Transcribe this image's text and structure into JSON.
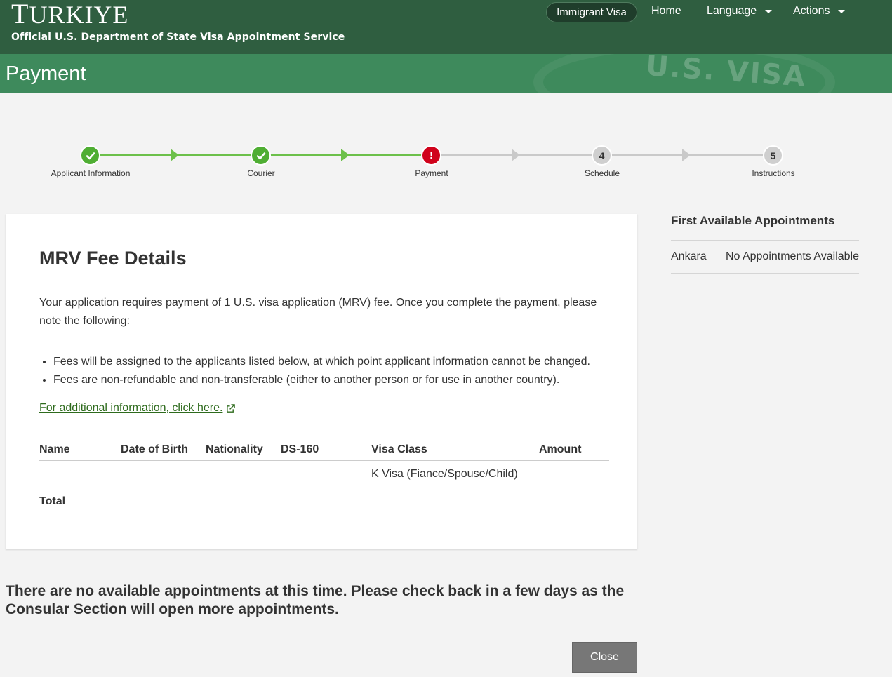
{
  "header": {
    "country_first": "T",
    "country_rest": "URKIYE",
    "subtitle": "Official U.S. Department of State Visa Appointment Service",
    "nav": {
      "immigrant_visa": "Immigrant Visa",
      "home": "Home",
      "language": "Language",
      "actions": "Actions"
    }
  },
  "page": {
    "title": "Payment",
    "watermark": "U.S. VISA"
  },
  "stepper": {
    "steps": [
      {
        "label": "Applicant Information",
        "status": "done",
        "number": ""
      },
      {
        "label": "Courier",
        "status": "done",
        "number": ""
      },
      {
        "label": "Payment",
        "status": "error",
        "number": "!"
      },
      {
        "label": "Schedule",
        "status": "todo",
        "number": "4"
      },
      {
        "label": "Instructions",
        "status": "todo",
        "number": "5"
      }
    ],
    "colors": {
      "done": "#4fae33",
      "error": "#d0021b",
      "todo": "#cfcfcf"
    }
  },
  "fee": {
    "heading": "MRV Fee Details",
    "intro": "Your application requires payment of 1 U.S. visa application (MRV) fee. Once you complete the payment, please note the following:",
    "bullets": [
      "Fees will be assigned to the applicants listed below, at which point applicant information cannot be changed.",
      "Fees are non-refundable and non-transferable (either to another person or for use in another country)."
    ],
    "link_text": "For additional information, click here.",
    "table": {
      "columns": [
        "Name",
        "Date of Birth",
        "Nationality",
        "DS-160",
        "Visa Class",
        "Amount"
      ],
      "rows": [
        {
          "name": "",
          "dob": "",
          "nationality": "",
          "ds160": "",
          "visa_class": "K Visa (Fiance/Spouse/Child)",
          "amount": ""
        }
      ],
      "total_label": "Total"
    }
  },
  "side": {
    "title": "First Available Appointments",
    "rows": [
      {
        "city": "Ankara",
        "status": "No Appointments Available"
      }
    ]
  },
  "notice": "There are no available appointments at this time. Please check back in a few days as the Consular Section will open more appointments.",
  "buttons": {
    "close": "Close"
  }
}
